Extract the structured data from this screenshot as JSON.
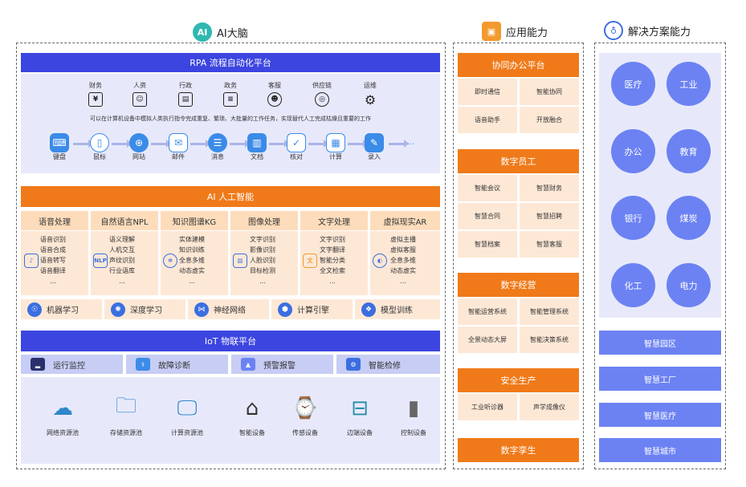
{
  "headers": {
    "ai_brain": "AI大脑",
    "app_ability": "应用能力",
    "solution_ability": "解决方案能力"
  },
  "rpa": {
    "title": "RPA 流程自动化平台",
    "departments": [
      "财务",
      "人资",
      "行政",
      "政务",
      "客服",
      "供应链",
      "运维"
    ],
    "description": "可以在计算机设备中模拟人类执行指令完成重复、繁琐、大批量的工作任务，实现替代人工完成枯燥且重要的工作",
    "flow": [
      "键盘",
      "鼠标",
      "网站",
      "邮件",
      "消息",
      "文档",
      "核对",
      "计算",
      "录入"
    ],
    "flow_more": "..."
  },
  "ai": {
    "title": "AI 人工智能",
    "columns": [
      {
        "name": "语音处理",
        "items": [
          "语音识别",
          "语音合成",
          "语音转写",
          "语音翻译",
          "..."
        ]
      },
      {
        "name": "自然语言NPL",
        "items": [
          "语义理解",
          "人机交互",
          "声纹识别",
          "行业语库",
          "..."
        ]
      },
      {
        "name": "知识图谱KG",
        "items": [
          "实体建模",
          "知识训练",
          "全息多维",
          "动态虚实",
          "..."
        ]
      },
      {
        "name": "图像处理",
        "items": [
          "文字识别",
          "影像识别",
          "人脸识别",
          "目标检测",
          "..."
        ]
      },
      {
        "name": "文字处理",
        "items": [
          "文字识别",
          "文字翻译",
          "智能分类",
          "全文检索",
          "..."
        ]
      },
      {
        "name": "虚拟现实AR",
        "items": [
          "虚拟主播",
          "虚拟客服",
          "全息多维",
          "动态虚实",
          "..."
        ]
      }
    ],
    "ml": [
      "机器学习",
      "深度学习",
      "神经网络",
      "计算引擎",
      "模型训练"
    ]
  },
  "iot": {
    "title": "IoT 物联平台",
    "functions": [
      "运行监控",
      "故障诊断",
      "预警报警",
      "智能检修"
    ],
    "devices": [
      "网络资源池",
      "存储资源池",
      "计算资源池",
      "智能设备",
      "传感设备",
      "边端设备",
      "控制设备"
    ]
  },
  "apps": [
    {
      "title": "协同办公平台",
      "items": [
        "即时通信",
        "智能协同",
        "语音助手",
        "开放融合"
      ]
    },
    {
      "title": "数字员工",
      "items": [
        "智能会议",
        "智慧财务",
        "智慧合同",
        "智慧招聘",
        "智慧档案",
        "智慧客服"
      ]
    },
    {
      "title": "数字经营",
      "items": [
        "智能运营系统",
        "智能管理系统",
        "全景动态大屏",
        "智能决策系统"
      ]
    },
    {
      "title": "安全生产",
      "items": [
        "工业听诊器",
        "声学成像仪"
      ]
    },
    {
      "title": "数字孪生",
      "items": []
    }
  ],
  "solutions": {
    "industries": [
      "医疗",
      "工业",
      "办公",
      "教育",
      "银行",
      "煤炭",
      "化工",
      "电力"
    ],
    "buttons": [
      "智慧园区",
      "智慧工厂",
      "智慧医疗",
      "智慧城市"
    ]
  },
  "colors": {
    "blue": "#3c45e0",
    "orange": "#f07a19",
    "light_blue": "#e7e9fb",
    "light_orange": "#fde8d6",
    "circle": "#6c82f3"
  }
}
